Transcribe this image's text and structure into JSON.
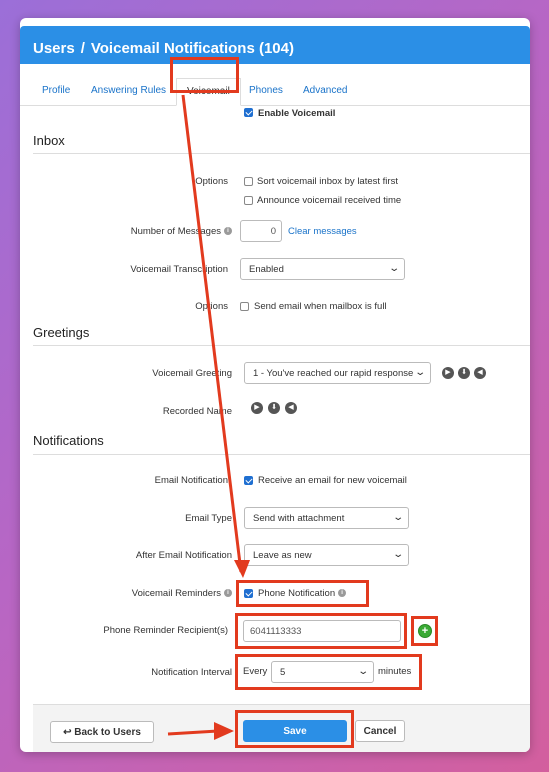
{
  "header": {
    "crumb_users": "Users",
    "separator": "/",
    "title": "Voicemail Notifications (104)"
  },
  "tabs": [
    {
      "label": "Profile"
    },
    {
      "label": "Answering Rules"
    },
    {
      "label": "Voicemail"
    },
    {
      "label": "Phones"
    },
    {
      "label": "Advanced"
    }
  ],
  "enable_voicemail": {
    "label": "Enable Voicemail",
    "checked": true
  },
  "inbox": {
    "title": "Inbox",
    "options_label": "Options",
    "sort_latest_label": "Sort voicemail inbox by latest first",
    "announce_time_label": "Announce voicemail received time",
    "num_messages_label": "Number of Messages",
    "num_messages_value": "0",
    "clear_messages_label": "Clear messages",
    "transcription_label": "Voicemail Transcription",
    "transcription_value": "Enabled",
    "options2_label": "Options",
    "send_email_full_label": "Send email when mailbox is full"
  },
  "greetings": {
    "title": "Greetings",
    "voicemail_greeting_label": "Voicemail Greeting",
    "voicemail_greeting_value": "1 - You've reached our rapid response",
    "recorded_name_label": "Recorded Name"
  },
  "notifications": {
    "title": "Notifications",
    "email_notification_label": "Email Notification",
    "email_notification_option": "Receive an email for new voicemail",
    "email_type_label": "Email Type",
    "email_type_value": "Send with attachment",
    "after_email_label": "After Email Notification",
    "after_email_value": "Leave as new",
    "reminders_label": "Voicemail Reminders",
    "phone_notification_label": "Phone Notification",
    "recipients_label": "Phone Reminder Recipient(s)",
    "recipients_value": "6041113333",
    "interval_label": "Notification Interval",
    "interval_prefix": "Every",
    "interval_value": "5",
    "interval_suffix": "minutes"
  },
  "footer": {
    "back_label": "Back to Users",
    "save_label": "Save",
    "cancel_label": "Cancel"
  },
  "colors": {
    "accent": "#2b8fe6",
    "highlight": "#e23a1e",
    "add": "#3aaa35"
  }
}
